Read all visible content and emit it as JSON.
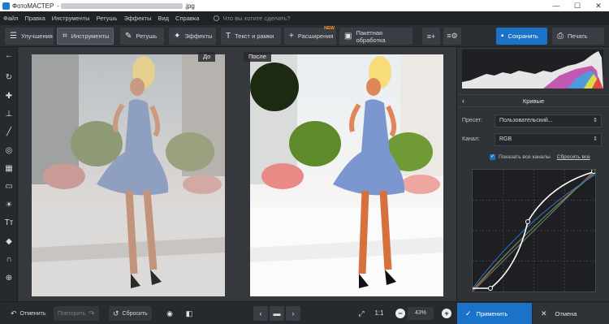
{
  "titlebar": {
    "title": "ФотоМАСТЕР",
    "filename_suffix": ".jpg",
    "minimize": "—",
    "maximize": "☐",
    "close": "✕"
  },
  "menu": {
    "items": [
      "Файл",
      "Правка",
      "Инструменты",
      "Ретушь",
      "Эффекты",
      "Вид",
      "Справка"
    ],
    "search_placeholder": "Что вы хотите сделать?"
  },
  "toolbar": {
    "enhance": "Улучшения",
    "tools": "Инструменты",
    "retouch": "Ретушь",
    "effects": "Эффекты",
    "text": "Текст и рамки",
    "extensions": "Расширения",
    "extensions_badge": "NEW",
    "batch": "Пакетная обработка",
    "save": "Сохранить",
    "print": "Печать"
  },
  "canvas": {
    "before_label": "До",
    "after_label": "После"
  },
  "panel": {
    "title": "Кривые",
    "preset_label": "Пресет:",
    "preset_value": "Пользовательский...",
    "channel_label": "Канал:",
    "channel_value": "RGB",
    "show_channels": "Показать все каналы",
    "reset_all": "Сбросить все"
  },
  "bottom": {
    "undo": "Отменить",
    "redo": "Повторить",
    "reset": "Сбросить",
    "zoom_fit": "1:1",
    "zoom_value": "43%",
    "apply": "Применить",
    "cancel": "Отмена"
  },
  "colors": {
    "accent": "#1a73c9",
    "panel_bg": "#2f3237",
    "canvas_bg": "#35383d",
    "new_badge": "#ff9a2a"
  }
}
